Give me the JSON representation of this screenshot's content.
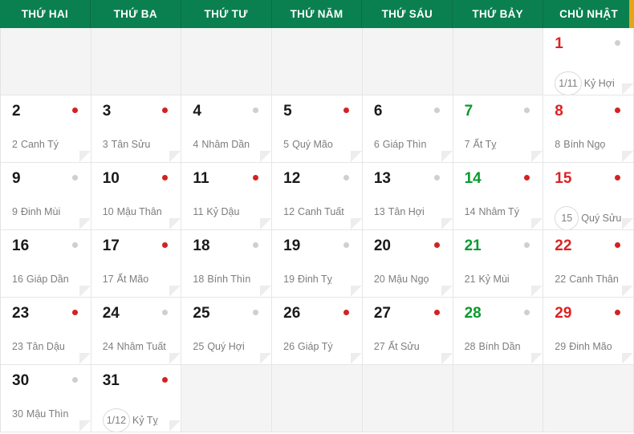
{
  "header": {
    "weekdays": [
      "THỨ HAI",
      "THỨ BA",
      "THỨ TƯ",
      "THỨ NĂM",
      "THỨ SÁU",
      "THỨ BẢY",
      "CHỦ NHẬT"
    ],
    "background_color": "#0a8050",
    "accent_color": "#e8a317",
    "text_color": "#ffffff"
  },
  "colors": {
    "solar_default": "#1a1a1a",
    "solar_saturday": "#0a9a2e",
    "solar_sunday": "#dd2222",
    "dot_red": "#d42222",
    "dot_gray": "#cfcfcf",
    "lunar_text": "#808080",
    "empty_cell": "#f4f4f4",
    "filled_cell": "#ffffff"
  },
  "weeks": [
    [
      {
        "empty": true
      },
      {
        "empty": true
      },
      {
        "empty": true
      },
      {
        "empty": true
      },
      {
        "empty": true
      },
      {
        "empty": true
      },
      {
        "empty": false,
        "solar": "1",
        "solar_color": "sunday",
        "dot": "gray",
        "lunar_num": "1/11",
        "lunar_circled": true,
        "lunar_name": "Kỷ Hợi"
      }
    ],
    [
      {
        "empty": false,
        "solar": "2",
        "solar_color": "default",
        "dot": "red",
        "lunar_num": "2",
        "lunar_circled": false,
        "lunar_name": "Canh Tý"
      },
      {
        "empty": false,
        "solar": "3",
        "solar_color": "default",
        "dot": "red",
        "lunar_num": "3",
        "lunar_circled": false,
        "lunar_name": "Tân Sửu"
      },
      {
        "empty": false,
        "solar": "4",
        "solar_color": "default",
        "dot": "gray",
        "lunar_num": "4",
        "lunar_circled": false,
        "lunar_name": "Nhâm Dần"
      },
      {
        "empty": false,
        "solar": "5",
        "solar_color": "default",
        "dot": "red",
        "lunar_num": "5",
        "lunar_circled": false,
        "lunar_name": "Quý Mão"
      },
      {
        "empty": false,
        "solar": "6",
        "solar_color": "default",
        "dot": "gray",
        "lunar_num": "6",
        "lunar_circled": false,
        "lunar_name": "Giáp Thìn"
      },
      {
        "empty": false,
        "solar": "7",
        "solar_color": "saturday",
        "dot": "gray",
        "lunar_num": "7",
        "lunar_circled": false,
        "lunar_name": "Ất Tỵ"
      },
      {
        "empty": false,
        "solar": "8",
        "solar_color": "sunday",
        "dot": "red",
        "lunar_num": "8",
        "lunar_circled": false,
        "lunar_name": "Bính Ngọ"
      }
    ],
    [
      {
        "empty": false,
        "solar": "9",
        "solar_color": "default",
        "dot": "gray",
        "lunar_num": "9",
        "lunar_circled": false,
        "lunar_name": "Đinh Mùi"
      },
      {
        "empty": false,
        "solar": "10",
        "solar_color": "default",
        "dot": "red",
        "lunar_num": "10",
        "lunar_circled": false,
        "lunar_name": "Mậu Thân"
      },
      {
        "empty": false,
        "solar": "11",
        "solar_color": "default",
        "dot": "red",
        "lunar_num": "11",
        "lunar_circled": false,
        "lunar_name": "Kỷ Dậu"
      },
      {
        "empty": false,
        "solar": "12",
        "solar_color": "default",
        "dot": "gray",
        "lunar_num": "12",
        "lunar_circled": false,
        "lunar_name": "Canh Tuất"
      },
      {
        "empty": false,
        "solar": "13",
        "solar_color": "default",
        "dot": "gray",
        "lunar_num": "13",
        "lunar_circled": false,
        "lunar_name": "Tân Hợi"
      },
      {
        "empty": false,
        "solar": "14",
        "solar_color": "saturday",
        "dot": "red",
        "lunar_num": "14",
        "lunar_circled": false,
        "lunar_name": "Nhâm Tý"
      },
      {
        "empty": false,
        "solar": "15",
        "solar_color": "sunday",
        "dot": "red",
        "lunar_num": "15",
        "lunar_circled": true,
        "lunar_name": "Quý Sửu"
      }
    ],
    [
      {
        "empty": false,
        "solar": "16",
        "solar_color": "default",
        "dot": "gray",
        "lunar_num": "16",
        "lunar_circled": false,
        "lunar_name": "Giáp Dần"
      },
      {
        "empty": false,
        "solar": "17",
        "solar_color": "default",
        "dot": "red",
        "lunar_num": "17",
        "lunar_circled": false,
        "lunar_name": "Ất Mão"
      },
      {
        "empty": false,
        "solar": "18",
        "solar_color": "default",
        "dot": "gray",
        "lunar_num": "18",
        "lunar_circled": false,
        "lunar_name": "Bính Thìn"
      },
      {
        "empty": false,
        "solar": "19",
        "solar_color": "default",
        "dot": "gray",
        "lunar_num": "19",
        "lunar_circled": false,
        "lunar_name": "Đinh Tỵ"
      },
      {
        "empty": false,
        "solar": "20",
        "solar_color": "default",
        "dot": "red",
        "lunar_num": "20",
        "lunar_circled": false,
        "lunar_name": "Mậu Ngọ"
      },
      {
        "empty": false,
        "solar": "21",
        "solar_color": "saturday",
        "dot": "gray",
        "lunar_num": "21",
        "lunar_circled": false,
        "lunar_name": "Kỷ Mùi"
      },
      {
        "empty": false,
        "solar": "22",
        "solar_color": "sunday",
        "dot": "red",
        "lunar_num": "22",
        "lunar_circled": false,
        "lunar_name": "Canh Thân"
      }
    ],
    [
      {
        "empty": false,
        "solar": "23",
        "solar_color": "default",
        "dot": "red",
        "lunar_num": "23",
        "lunar_circled": false,
        "lunar_name": "Tân Dậu"
      },
      {
        "empty": false,
        "solar": "24",
        "solar_color": "default",
        "dot": "gray",
        "lunar_num": "24",
        "lunar_circled": false,
        "lunar_name": "Nhâm Tuất"
      },
      {
        "empty": false,
        "solar": "25",
        "solar_color": "default",
        "dot": "gray",
        "lunar_num": "25",
        "lunar_circled": false,
        "lunar_name": "Quý Hợi"
      },
      {
        "empty": false,
        "solar": "26",
        "solar_color": "default",
        "dot": "red",
        "lunar_num": "26",
        "lunar_circled": false,
        "lunar_name": "Giáp Tý"
      },
      {
        "empty": false,
        "solar": "27",
        "solar_color": "default",
        "dot": "red",
        "lunar_num": "27",
        "lunar_circled": false,
        "lunar_name": "Ất Sửu"
      },
      {
        "empty": false,
        "solar": "28",
        "solar_color": "saturday",
        "dot": "gray",
        "lunar_num": "28",
        "lunar_circled": false,
        "lunar_name": "Bính Dần"
      },
      {
        "empty": false,
        "solar": "29",
        "solar_color": "sunday",
        "dot": "red",
        "lunar_num": "29",
        "lunar_circled": false,
        "lunar_name": "Đinh Mão"
      }
    ],
    [
      {
        "empty": false,
        "solar": "30",
        "solar_color": "default",
        "dot": "gray",
        "lunar_num": "30",
        "lunar_circled": false,
        "lunar_name": "Mậu Thìn"
      },
      {
        "empty": false,
        "solar": "31",
        "solar_color": "default",
        "dot": "red",
        "lunar_num": "1/12",
        "lunar_circled": true,
        "lunar_name": "Kỷ Tỵ"
      },
      {
        "empty": true
      },
      {
        "empty": true
      },
      {
        "empty": true
      },
      {
        "empty": true
      },
      {
        "empty": true
      }
    ]
  ]
}
